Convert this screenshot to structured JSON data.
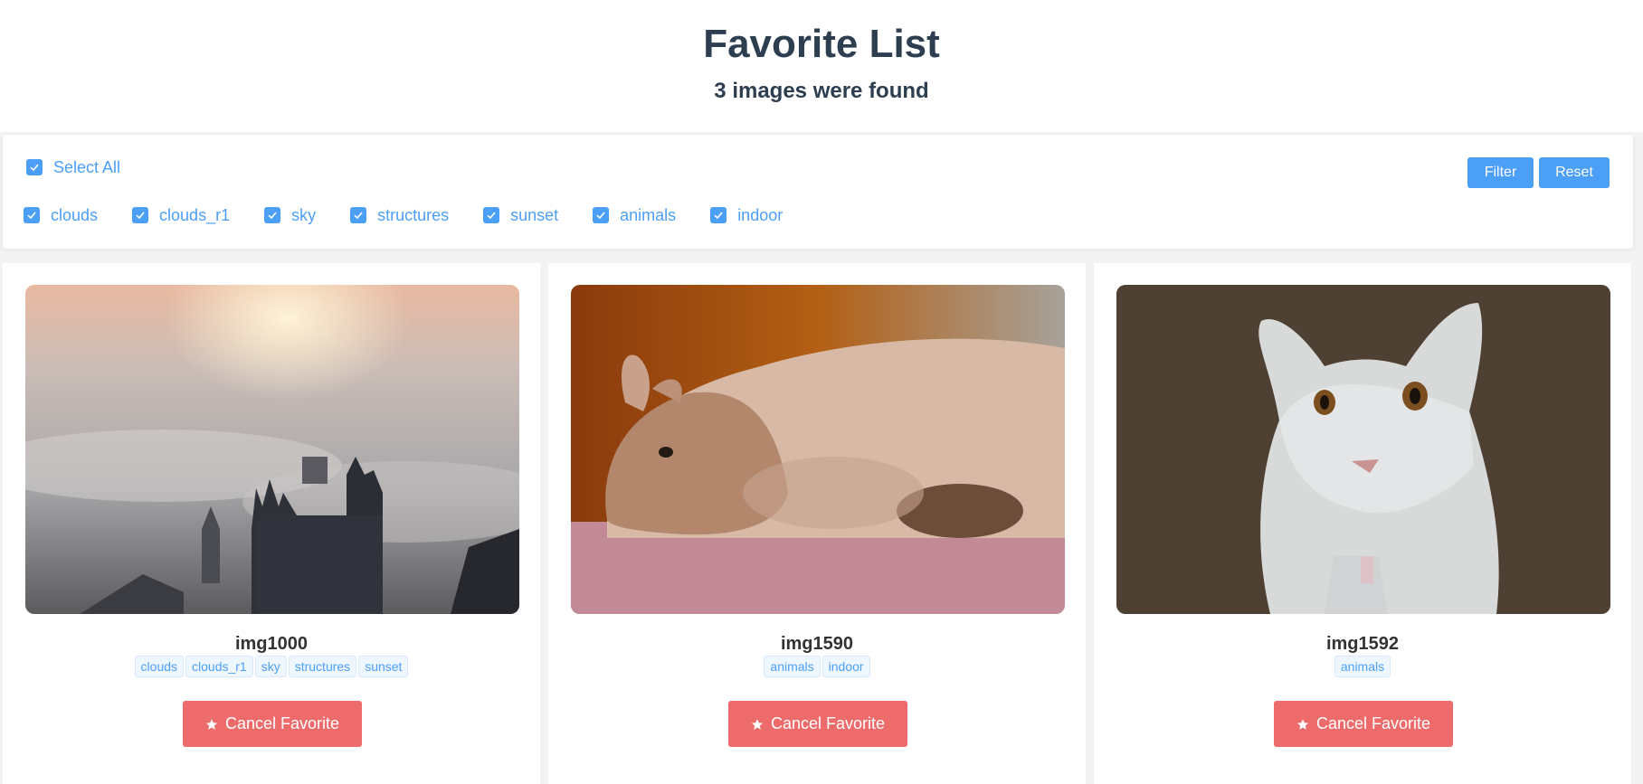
{
  "header": {
    "title": "Favorite List",
    "subtitle": "3 images were found"
  },
  "filter": {
    "select_all_label": "Select All",
    "select_all_checked": true,
    "tags": [
      {
        "label": "clouds",
        "checked": true
      },
      {
        "label": "clouds_r1",
        "checked": true
      },
      {
        "label": "sky",
        "checked": true
      },
      {
        "label": "structures",
        "checked": true
      },
      {
        "label": "sunset",
        "checked": true
      },
      {
        "label": "animals",
        "checked": true
      },
      {
        "label": "indoor",
        "checked": true
      }
    ],
    "filter_label": "Filter",
    "reset_label": "Reset"
  },
  "cards": [
    {
      "name": "img1000",
      "tags": [
        "clouds",
        "clouds_r1",
        "sky",
        "structures",
        "sunset"
      ],
      "button_label": "Cancel Favorite"
    },
    {
      "name": "img1590",
      "tags": [
        "animals",
        "indoor"
      ],
      "button_label": "Cancel Favorite"
    },
    {
      "name": "img1592",
      "tags": [
        "animals"
      ],
      "button_label": "Cancel Favorite"
    }
  ],
  "colors": {
    "primary": "#4c9ff7",
    "danger": "#ee6b6b",
    "heading": "#2c3e50"
  },
  "icons": {
    "checkbox": "checkmark-icon",
    "cancel_button": "star-icon"
  }
}
